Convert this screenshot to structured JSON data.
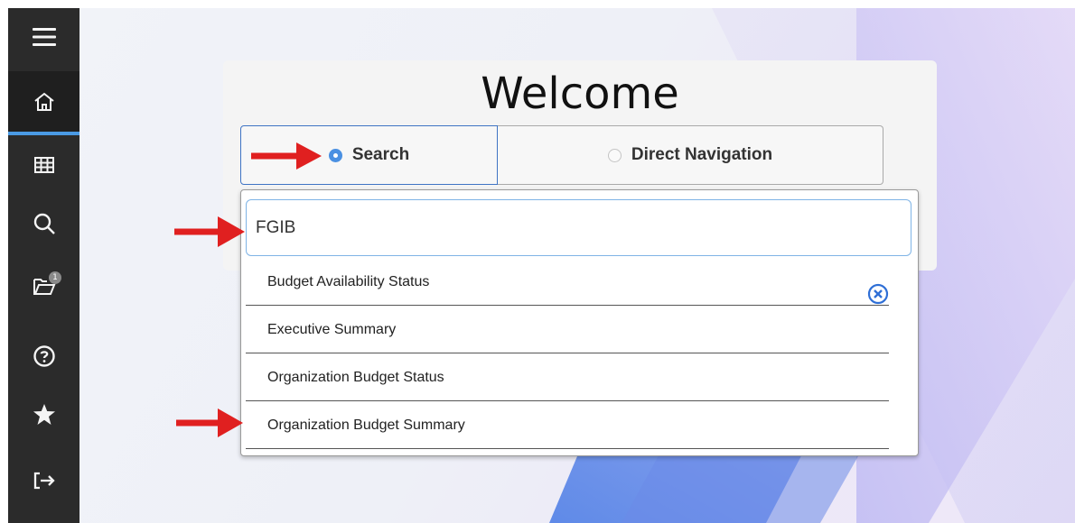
{
  "sidebar": {
    "items": [
      {
        "name": "menu",
        "icon": "hamburger-menu-icon"
      },
      {
        "name": "home",
        "icon": "home-icon"
      },
      {
        "name": "applications",
        "icon": "grid-icon"
      },
      {
        "name": "search",
        "icon": "search-icon"
      },
      {
        "name": "recent",
        "icon": "folder-open-icon",
        "badge": "1"
      },
      {
        "name": "help",
        "icon": "question-circle-icon"
      },
      {
        "name": "favorites",
        "icon": "star-icon"
      },
      {
        "name": "sign-out",
        "icon": "sign-out-icon"
      }
    ],
    "active": "home",
    "accent": "#4a9ae4"
  },
  "welcome": {
    "title": "Welcome"
  },
  "mode": {
    "search_label": "Search",
    "direct_label": "Direct Navigation",
    "selected": "search"
  },
  "search": {
    "value": "FGIB",
    "options": [
      "Budget Availability Status",
      "Executive Summary",
      "Organization Budget Status",
      "Organization Budget Summary"
    ]
  },
  "annotations": {
    "arrow_color": "#e02020"
  }
}
